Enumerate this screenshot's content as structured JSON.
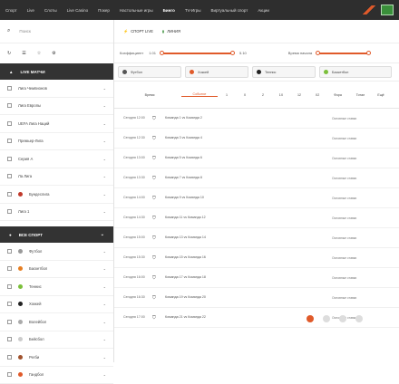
{
  "topnav": {
    "items": [
      "Спорт",
      "Live",
      "Слоты",
      "Live Casino",
      "Покер",
      "Настольные игры",
      "Бинго",
      "TV-Игры",
      "Виртуальный спорт",
      "Акции"
    ]
  },
  "sidebar": {
    "search_placeholder": "Поиск",
    "live_section": "LIVE МАТЧИ",
    "live_items": [
      "Лига Чемпионов",
      "Лига Европы",
      "UEFA Лига Наций",
      "Премьер-Лига",
      "Серия А",
      "Ла Лига",
      "Бундеслига",
      "Лига 1"
    ],
    "sports_section": "ВСЕ СПОРТ",
    "sports_items": [
      "Футбол",
      "Баскетбол",
      "Теннис",
      "Хоккей",
      "Волейбол",
      "Бейсбол",
      "Регби",
      "Гандбол"
    ]
  },
  "main": {
    "top_btn1": "СПОРТ LIVE",
    "top_btn2": "ЛИНИЯ",
    "slider1_label": "Коэффициент",
    "slider1_min": "1.01",
    "slider1_max": "5.10",
    "slider2_label": "Время начала",
    "filters": [
      "Футбол",
      "Хоккей",
      "Теннис",
      "Баскетбол"
    ],
    "columns": [
      "Время",
      "Событие",
      "1",
      "X",
      "2",
      "1X",
      "12",
      "X2",
      "Фора",
      "Тотал",
      "Ещё"
    ],
    "rows": [
      {
        "time": "Сегодня 12:00",
        "teams": "Команда 1 vs Команда 2",
        "market": "Основные ставки"
      },
      {
        "time": "Сегодня 12:30",
        "teams": "Команда 3 vs Команда 4",
        "market": "Основные ставки"
      },
      {
        "time": "Сегодня 13:00",
        "teams": "Команда 5 vs Команда 6",
        "market": "Основные ставки"
      },
      {
        "time": "Сегодня 13:30",
        "teams": "Команда 7 vs Команда 8",
        "market": "Основные ставки"
      },
      {
        "time": "Сегодня 14:00",
        "teams": "Команда 9 vs Команда 10",
        "market": "Основные ставки"
      },
      {
        "time": "Сегодня 14:30",
        "teams": "Команда 11 vs Команда 12",
        "market": "Основные ставки"
      },
      {
        "time": "Сегодня 15:00",
        "teams": "Команда 13 vs Команда 14",
        "market": "Основные ставки"
      },
      {
        "time": "Сегодня 15:30",
        "teams": "Команда 15 vs Команда 16",
        "market": "Основные ставки"
      },
      {
        "time": "Сегодня 16:00",
        "teams": "Команда 17 vs Команда 18",
        "market": "Основные ставки"
      },
      {
        "time": "Сегодня 16:30",
        "teams": "Команда 19 vs Команда 20",
        "market": "Основные ставки"
      },
      {
        "time": "Сегодня 17:00",
        "teams": "Команда 21 vs Команда 22",
        "market": "Основные ставки"
      }
    ]
  },
  "colors": {
    "accent": "#e05a2a",
    "dark": "#2e2e2e"
  }
}
